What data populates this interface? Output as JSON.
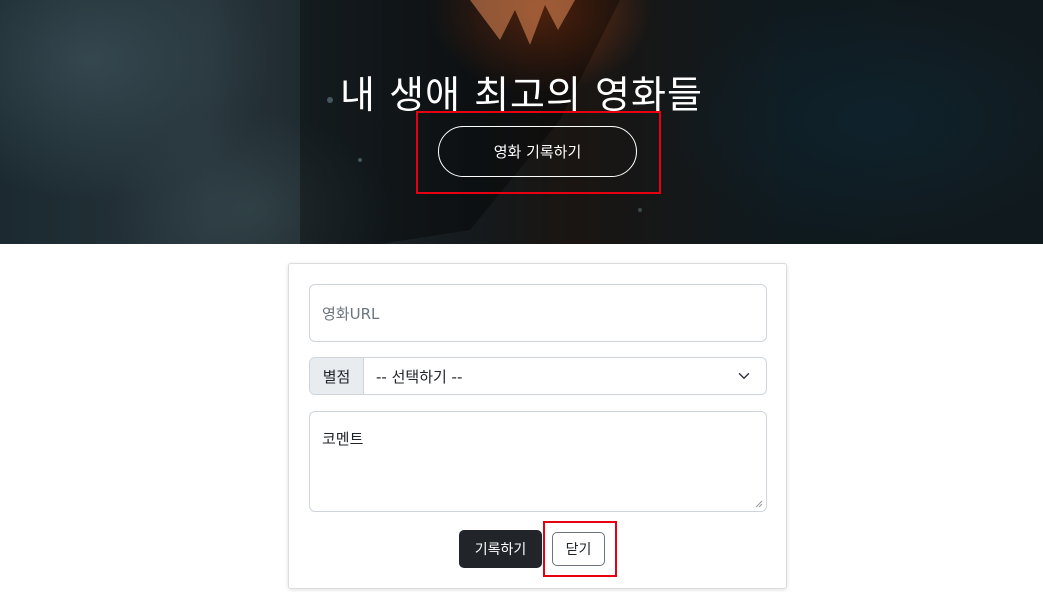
{
  "hero": {
    "title": "내 생애 최고의 영화들",
    "record_button_label": "영화 기록하기"
  },
  "form": {
    "url_placeholder": "영화URL",
    "rating_label": "별점",
    "rating_selected": "-- 선택하기 --",
    "comment_placeholder": "코멘트",
    "save_button_label": "기록하기",
    "close_button_label": "닫기"
  },
  "colors": {
    "highlight": "#e60012",
    "primary_button": "#212529"
  },
  "icons": {
    "select_arrow": "chevron-down-icon",
    "textarea_resize": "resize-handle-icon"
  }
}
